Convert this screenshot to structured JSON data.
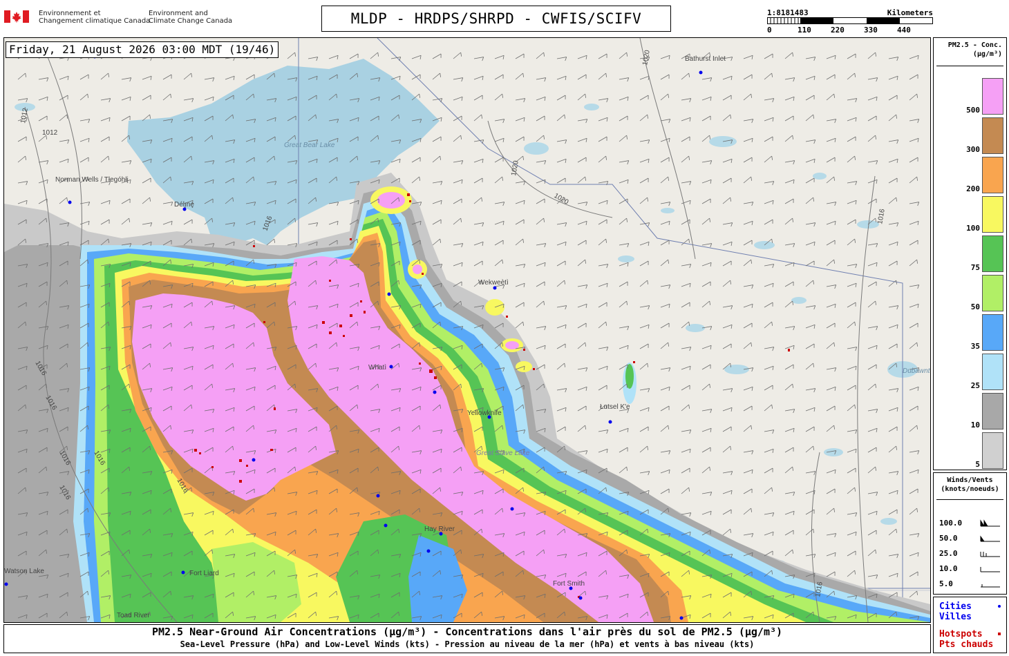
{
  "header": {
    "dept_fr": [
      "Environnement et",
      "Changement climatique Canada"
    ],
    "dept_en": [
      "Environment and",
      "Climate Change Canada"
    ],
    "title": "MLDP - HRDPS/SHRPD - CWFIS/SCIFV"
  },
  "scale_bar": {
    "ratio": "1:8181483",
    "unit": "Kilometers",
    "ticks": [
      "0",
      "110",
      "220",
      "330",
      "440"
    ]
  },
  "map": {
    "datetime": "Friday, 21 August 2026 03:00 MDT (19/46)",
    "place_labels": [
      "Norman Wells / Tłegóhłį",
      "Délı̨nę",
      "Great Bear Lake",
      "Bathurst Inlet",
      "Wekweètì",
      "Whatì",
      "Yellowknife",
      "Great Slave Lake",
      "Łutsel K'e",
      "Dubawnt Lake",
      "Hay River",
      "Fort Smith",
      "Fort Liard",
      "Toad River",
      "Watson Lake"
    ],
    "isobar_labels": [
      "1012",
      "1012",
      "1016",
      "1016",
      "1016",
      "1016",
      "1016",
      "1016",
      "1016",
      "1020",
      "1020",
      "1020",
      "1016",
      "1016"
    ]
  },
  "legend_pm": {
    "title_line1": "PM2.5 - Conc.",
    "title_line2": "(µg/m³)",
    "levels": [
      {
        "label": "500",
        "color": "#f5a0f5"
      },
      {
        "label": "300",
        "color": "#c48a52"
      },
      {
        "label": "200",
        "color": "#f9a54f"
      },
      {
        "label": "100",
        "color": "#f8f860"
      },
      {
        "label": "75",
        "color": "#56c455"
      },
      {
        "label": "50",
        "color": "#b1ef66"
      },
      {
        "label": "35",
        "color": "#58a8f8"
      },
      {
        "label": "25",
        "color": "#b0e2f8"
      },
      {
        "label": "10",
        "color": "#a8a8a8"
      },
      {
        "label": "5",
        "color": "#d0d0d0"
      }
    ]
  },
  "legend_wind": {
    "title_line1": "Winds/Vents",
    "title_line2": "(knots/noeuds)",
    "rows": [
      "100.0",
      "50.0",
      "25.0",
      "10.0",
      "5.0"
    ]
  },
  "legend_points": {
    "cities_en": "Cities",
    "cities_fr": "Villes",
    "hotspots_en": "Hotspots",
    "hotspots_fr": "Pts chauds",
    "city_color": "#0000ee",
    "hotspot_color": "#cc0000"
  },
  "footer": {
    "line1": "PM2.5 Near-Ground Air Concentrations (µg/m³) - Concentrations dans l'air près du sol de PM2.5 (µg/m³)",
    "line2": "Sea-Level Pressure (hPa) and Low-Level Winds (kts) - Pression au niveau de la mer (hPa) et vents à bas niveau (kts)"
  }
}
